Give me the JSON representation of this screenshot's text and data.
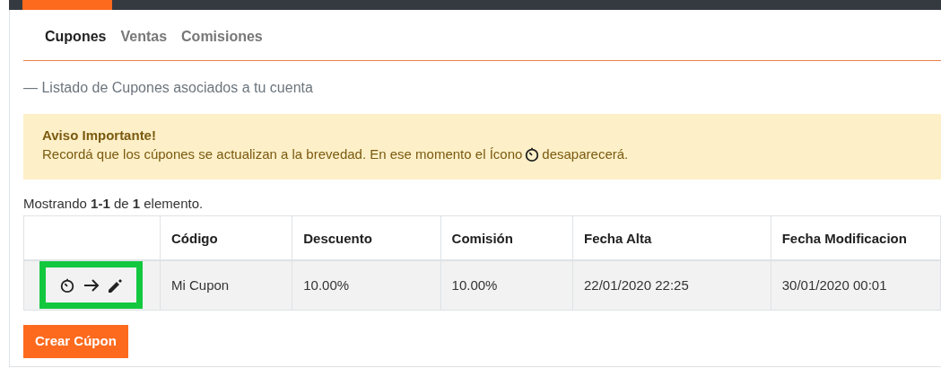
{
  "tabs": [
    {
      "label": "Cupones",
      "selected": true
    },
    {
      "label": "Ventas",
      "selected": false
    },
    {
      "label": "Comisiones",
      "selected": false
    }
  ],
  "subtitle": "— Listado de Cupones asociados a tu cuenta",
  "alert": {
    "title": "Aviso Importante!",
    "message_before_icon": "Recordá que los cúpones se actualizan a la brevedad. En ese momento el Ícono",
    "message_after_icon": "desaparecerá."
  },
  "summary": "Mostrando **1-1** de **1** elemento.",
  "table": {
    "columns": [
      "",
      "Código",
      "Descuento",
      "Comisión",
      "Fecha Alta",
      "Fecha Modificacion"
    ],
    "rows": [
      {
        "actions_highlighted": true,
        "cells": [
          "",
          "Mi Cupon",
          "10.00%",
          "10.00%",
          "22/01/2020 22:25",
          "30/01/2020 00:01"
        ]
      }
    ]
  },
  "create_button": "Crear Cúpon"
}
